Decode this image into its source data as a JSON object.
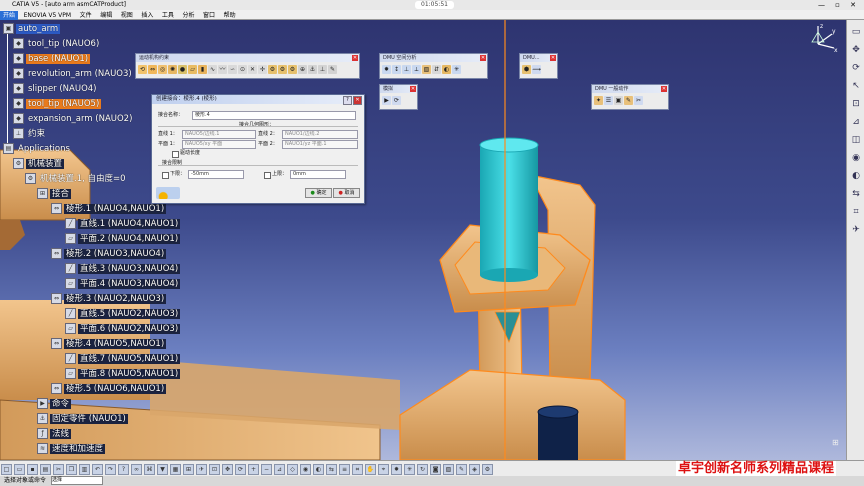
{
  "window": {
    "title": "CATIA V5 - [auto arm asmCATProduct]",
    "clock": "01:05:51",
    "win_buttons": "— ▫ ✕"
  },
  "menu": [
    "开始",
    "ENOVIA V5 VPM",
    "文件",
    "编辑",
    "视图",
    "插入",
    "工具",
    "分析",
    "窗口",
    "帮助"
  ],
  "tree": {
    "root": "auto_arm",
    "parts": [
      {
        "label": "tool_tip (NAUO6)",
        "style": ""
      },
      {
        "label": "base (NAUO1)",
        "style": "hl"
      },
      {
        "label": "revolution_arm (NAUO3)",
        "style": ""
      },
      {
        "label": "slipper (NAUO4)",
        "style": ""
      },
      {
        "label": "tool_tip (NAUO5)",
        "style": "hl"
      },
      {
        "label": "expansion_arm (NAUO2)",
        "style": ""
      },
      {
        "label": "约束",
        "style": ""
      },
      {
        "label": "Applications",
        "style": ""
      }
    ],
    "mechanism": [
      "机械装置",
      "机械装置.1, 自由度=0",
      "接合"
    ],
    "joints": [
      {
        "label": "棱形.1 (NAUO4,NAUO1)",
        "children": [
          "直线.1 (NAUO4,NAUO1)",
          "平面.2 (NAUO4,NAUO1)"
        ]
      },
      {
        "label": "棱形.2 (NAUO3,NAUO4)",
        "children": [
          "直线.3 (NAUO3,NAUO4)",
          "平面.4 (NAUO3,NAUO4)"
        ]
      },
      {
        "label": "棱形.3 (NAUO2,NAUO3)",
        "children": [
          "直线.5 (NAUO2,NAUO3)",
          "平面.6 (NAUO2,NAUO3)"
        ]
      },
      {
        "label": "棱形.4 (NAUO5,NAUO1)",
        "children": [
          "直线.7 (NAUO5,NAUO1)",
          "平面.8 (NAUO5,NAUO1)"
        ]
      },
      {
        "label": "棱形.5 (NAUO6,NAUO1)",
        "children": []
      }
    ],
    "tail": [
      "命令",
      "固定零件 (NAUO1)",
      "法线",
      "速度和加速度"
    ]
  },
  "toolbars": {
    "kinematics": {
      "title": "运动机构约束"
    },
    "dmu_space": {
      "title": "DMU 空间分析"
    },
    "dmu_small": {
      "title": "DMU..."
    },
    "simulation": {
      "title": "模拟"
    },
    "dmu_general": {
      "title": "DMU 一般动作"
    }
  },
  "dialog": {
    "title": "创建接合：棱形.4 (棱形)",
    "name_label": "接合名称：",
    "name_value": "棱形.4",
    "geometry_label": "接合几何图形：",
    "line1_label": "直线 1：",
    "line1_value": "NAUO5/边线.1",
    "line2_label": "直线 2：",
    "line2_value": "NAUO1/边线.2",
    "plane1_label": "平面 1：",
    "plane1_value": "NAUO5/xy 平面",
    "plane2_label": "平面 2：",
    "plane2_value": "NAUO1/yz 平面.1",
    "option_label": "驱动长度",
    "limits_label": "接合限制",
    "lower_label": "下限：",
    "lower_value": "-50mm",
    "upper_label": "上限：",
    "upper_value": "0mm",
    "ok": "确定",
    "cancel": "取消"
  },
  "status": {
    "text": "选择对象或命令",
    "field_label": "选择"
  },
  "watermark": "卓宇创新名师系列精品课程",
  "compass_axes": [
    "x",
    "y",
    "z"
  ],
  "colors": {
    "part": "#e1aa6a",
    "part_edge": "#ff8a1c",
    "cyan": "#33c6cf",
    "dark_cyl": "#0f2248",
    "highlight": "#e87a1c"
  }
}
